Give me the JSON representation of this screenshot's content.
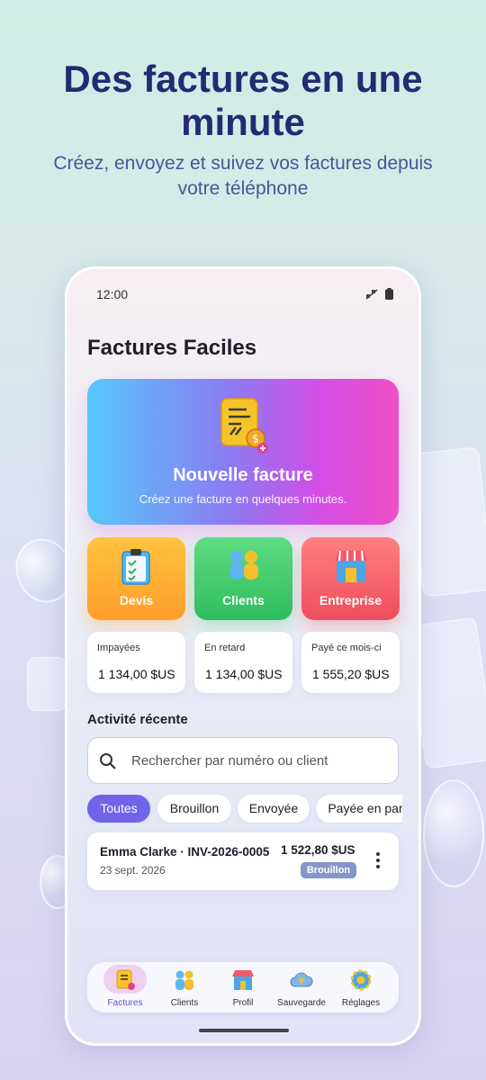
{
  "hero": {
    "title": "Des factures en une minute",
    "subtitle": "Créez, envoyez et suivez vos factures depuis votre téléphone"
  },
  "status_bar": {
    "time": "12:00",
    "icons": [
      "signal-icon",
      "battery-icon"
    ]
  },
  "app": {
    "title": "Factures Faciles"
  },
  "new_invoice": {
    "title": "Nouvelle facture",
    "subtitle": "Créez une facture en quelques minutes.",
    "icon": "invoice-add-icon"
  },
  "tiles": [
    {
      "label": "Devis",
      "icon": "clipboard-icon",
      "color": "#ffb035"
    },
    {
      "label": "Clients",
      "icon": "clients-icon",
      "color": "#3fc96b"
    },
    {
      "label": "Entreprise",
      "icon": "store-icon",
      "color": "#f5626d"
    }
  ],
  "stats": [
    {
      "label": "Impayées",
      "value": "1 134,00 $US"
    },
    {
      "label": "En retard",
      "value": "1 134,00 $US"
    },
    {
      "label": "Payé ce mois-ci",
      "value": "1 555,20 $US"
    }
  ],
  "recent": {
    "title": "Activité récente",
    "search_placeholder": "Rechercher par numéro ou client"
  },
  "filters": [
    {
      "label": "Toutes",
      "active": true
    },
    {
      "label": "Brouillon",
      "active": false
    },
    {
      "label": "Envoyée",
      "active": false
    },
    {
      "label": "Payée en par",
      "active": false
    }
  ],
  "invoices": [
    {
      "title": "Emma Clarke · INV-2026-0005",
      "date": "23 sept. 2026",
      "amount": "1 522,80 $US",
      "status": "Brouillon"
    }
  ],
  "nav": [
    {
      "label": "Factures",
      "icon": "invoice-icon",
      "active": true
    },
    {
      "label": "Clients",
      "icon": "clients-icon",
      "active": false
    },
    {
      "label": "Profil",
      "icon": "store-icon",
      "active": false
    },
    {
      "label": "Sauvegarde",
      "icon": "cloud-upload-icon",
      "active": false
    },
    {
      "label": "Réglages",
      "icon": "gear-icon",
      "active": false
    }
  ],
  "colors": {
    "accent": "#7064e8",
    "title": "#252a73",
    "badge": "#8597c9"
  }
}
